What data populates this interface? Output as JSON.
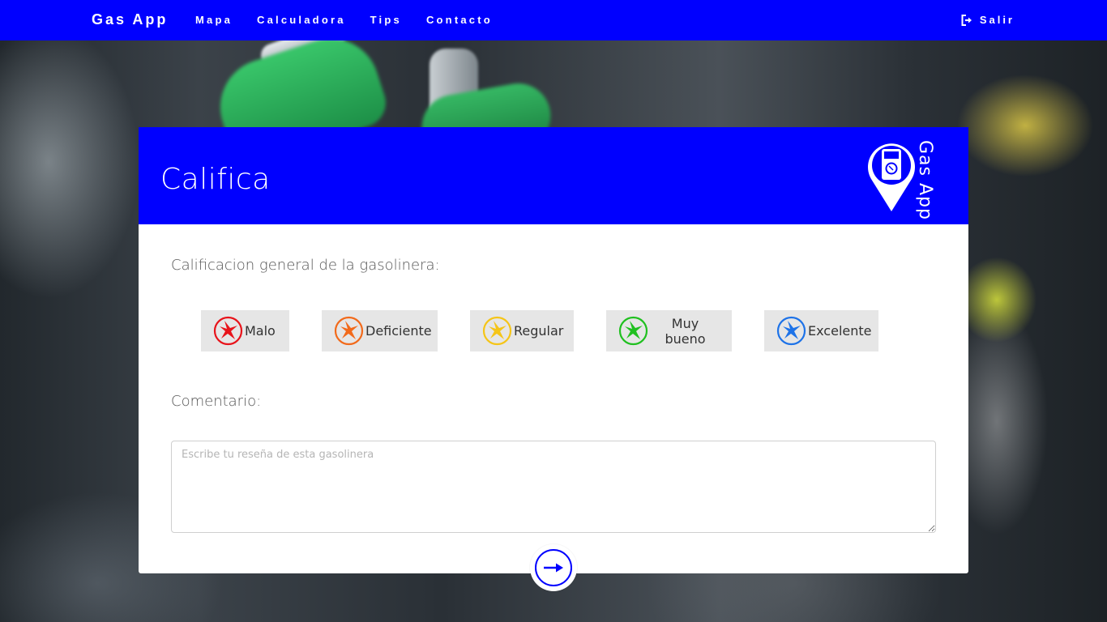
{
  "navbar": {
    "brand": "Gas App",
    "links": [
      "Mapa",
      "Calculadora",
      "Tips",
      "Contacto"
    ],
    "logout_label": "Salir",
    "background_color": "#0000ff"
  },
  "card": {
    "title": "Califica",
    "logo_text": "Gas App",
    "header_color": "#0000ff",
    "rating_label": "Calificacion general de la gasolinera:",
    "ratings": [
      {
        "label": "Malo",
        "color": "#e8141b"
      },
      {
        "label": "Deficiente",
        "color": "#f26a1b"
      },
      {
        "label": "Regular",
        "color": "#f5c518"
      },
      {
        "label": "Muy bueno",
        "color": "#20c020"
      },
      {
        "label": "Excelente",
        "color": "#1e73e8"
      }
    ],
    "comment_label": "Comentario:",
    "comment_placeholder": "Escribe tu reseña de esta gasolinera",
    "comment_value": "",
    "submit_icon": "arrow-right-icon"
  }
}
